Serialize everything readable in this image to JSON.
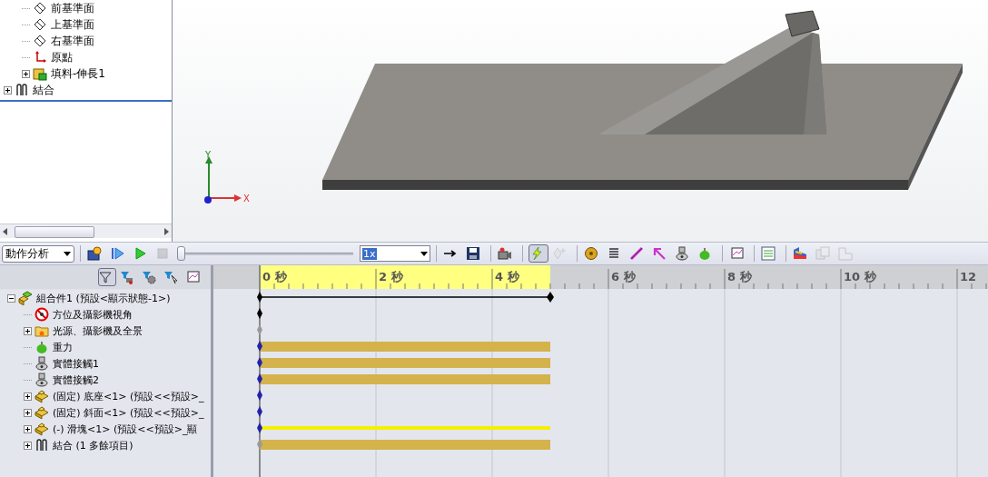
{
  "feature_tree": [
    {
      "children": [
        {
          "label": "前基準面",
          "kind": "plane",
          "expandable": false
        },
        {
          "label": "上基準面",
          "kind": "plane",
          "expandable": false
        },
        {
          "label": "右基準面",
          "kind": "plane",
          "expandable": false
        },
        {
          "label": "原點",
          "kind": "origin",
          "expandable": false
        },
        {
          "label": "填料-伸長1",
          "kind": "feature",
          "expandable": true
        }
      ]
    },
    {
      "label": "結合",
      "kind": "mates",
      "expandable": true
    }
  ],
  "view_triad": {
    "axis_labels": [
      "Y",
      "X"
    ]
  },
  "motion_toolbar": {
    "study_type": "動作分析",
    "playback": {
      "level": 0
    },
    "speed": "1x",
    "tools": [
      {
        "kind": "calculate",
        "pressed": false,
        "disabled": false
      },
      {
        "kind": "play-start",
        "pressed": false,
        "disabled": false
      },
      {
        "kind": "play",
        "pressed": false,
        "disabled": false
      },
      {
        "kind": "stop",
        "pressed": false,
        "disabled": true
      },
      {
        "kind": "sep"
      },
      {
        "kind": "playback-mode",
        "pressed": false,
        "disabled": false
      },
      {
        "kind": "save",
        "pressed": false,
        "disabled": false
      },
      {
        "kind": "sep"
      },
      {
        "kind": "animation-wizard",
        "pressed": false,
        "disabled": false
      },
      {
        "kind": "sep"
      },
      {
        "kind": "autokey",
        "pressed": true,
        "disabled": false
      },
      {
        "kind": "add-key",
        "pressed": false,
        "disabled": true
      },
      {
        "kind": "sep"
      },
      {
        "kind": "motor",
        "pressed": false,
        "disabled": false
      },
      {
        "kind": "spring",
        "pressed": false,
        "disabled": false
      },
      {
        "kind": "damper",
        "pressed": false,
        "disabled": false
      },
      {
        "kind": "force",
        "pressed": false,
        "disabled": false
      },
      {
        "kind": "contact",
        "pressed": false,
        "disabled": false
      },
      {
        "kind": "gravity",
        "pressed": false,
        "disabled": false
      },
      {
        "kind": "sep"
      },
      {
        "kind": "results",
        "pressed": false,
        "disabled": false
      },
      {
        "kind": "sep"
      },
      {
        "kind": "properties",
        "pressed": false,
        "disabled": false
      },
      {
        "kind": "sep"
      },
      {
        "kind": "color",
        "pressed": false,
        "disabled": false
      },
      {
        "kind": "copy",
        "pressed": false,
        "disabled": true
      },
      {
        "kind": "layout",
        "pressed": false,
        "disabled": true
      }
    ]
  },
  "filters": [
    {
      "kind": "filter",
      "pressed": true
    },
    {
      "kind": "animated",
      "pressed": false
    },
    {
      "kind": "driving",
      "pressed": false
    },
    {
      "kind": "selected",
      "pressed": false
    },
    {
      "kind": "results",
      "pressed": false
    }
  ],
  "timeline": {
    "ruler_labels": [
      "0 秒",
      "2 秒",
      "4 秒",
      "6 秒",
      "8 秒",
      "10 秒",
      "12"
    ]
  },
  "motion_tree": [
    {
      "label": "組合件1 (預設<顯示狀態-1>)",
      "kind": "assembly",
      "expanded": true,
      "color": "#000000",
      "span": true,
      "bar": false,
      "highlight": false,
      "children": [
        {
          "label": "方位及攝影機視角",
          "kind": "view",
          "expandable": false,
          "color": "#000000",
          "span": false,
          "bar": false,
          "highlight": false
        },
        {
          "label": "光源、攝影機及全景",
          "kind": "lights",
          "expandable": true,
          "color": "#999999",
          "span": false,
          "bar": false,
          "highlight": false
        },
        {
          "label": "重力",
          "kind": "gravity",
          "expandable": false,
          "color": "#2222aa",
          "span": false,
          "bar": true,
          "highlight": false
        },
        {
          "label": "實體接觸1",
          "kind": "contact",
          "expandable": false,
          "color": "#2222aa",
          "span": false,
          "bar": true,
          "highlight": false
        },
        {
          "label": "實體接觸2",
          "kind": "contact",
          "expandable": false,
          "color": "#2222aa",
          "span": false,
          "bar": true,
          "highlight": false
        },
        {
          "label": "(固定) 底座<1> (預設<<預設>_",
          "kind": "part",
          "expandable": true,
          "color": "#2222aa",
          "span": false,
          "bar": false,
          "highlight": false
        },
        {
          "label": "(固定) 斜面<1> (預設<<預設>_",
          "kind": "part",
          "expandable": true,
          "color": "#2222aa",
          "span": false,
          "bar": false,
          "highlight": false
        },
        {
          "label": "(-) 滑塊<1> (預設<<預設>_顯",
          "kind": "part",
          "expandable": true,
          "color": "#2222aa",
          "span": false,
          "bar": false,
          "highlight": true
        },
        {
          "label": "結合 (1 多餘項目)",
          "kind": "mates",
          "expandable": true,
          "color": "#999999",
          "span": false,
          "bar": true,
          "highlight": false
        }
      ]
    }
  ]
}
